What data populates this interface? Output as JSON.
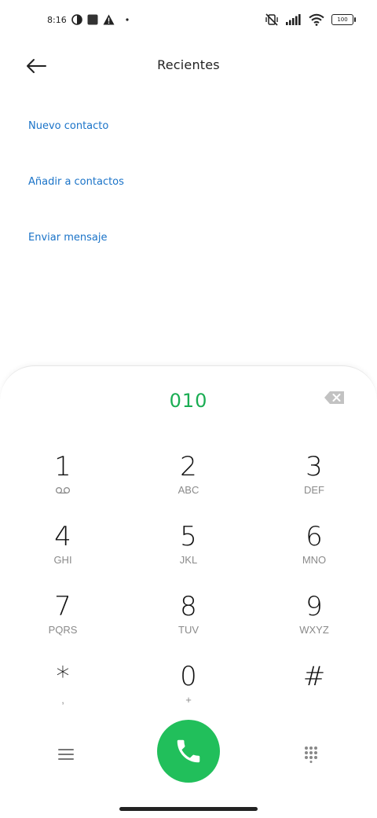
{
  "status_bar": {
    "time": "8:16",
    "battery_level": "100",
    "icons": [
      "data-saver-icon",
      "square-notification-icon",
      "warning-icon",
      "dot-icon",
      "vibrate-off-icon",
      "signal-icon",
      "wifi-icon",
      "battery-icon"
    ]
  },
  "header": {
    "title": "Recientes",
    "back_icon": "arrow-left-icon"
  },
  "actions": [
    {
      "label": "Nuevo contacto"
    },
    {
      "label": "Añadir a contactos"
    },
    {
      "label": "Enviar mensaje"
    }
  ],
  "dialer": {
    "number": "010",
    "keys": [
      {
        "digit": "1",
        "letters": "",
        "sub_icon": "voicemail-icon"
      },
      {
        "digit": "2",
        "letters": "ABC"
      },
      {
        "digit": "3",
        "letters": "DEF"
      },
      {
        "digit": "4",
        "letters": "GHI"
      },
      {
        "digit": "5",
        "letters": "JKL"
      },
      {
        "digit": "6",
        "letters": "MNO"
      },
      {
        "digit": "7",
        "letters": "PQRS"
      },
      {
        "digit": "8",
        "letters": "TUV"
      },
      {
        "digit": "9",
        "letters": "WXYZ"
      },
      {
        "digit": "*",
        "letters": ","
      },
      {
        "digit": "0",
        "letters": "+"
      },
      {
        "digit": "#",
        "letters": ""
      }
    ]
  },
  "colors": {
    "accent_link": "#1a73c8",
    "number_green": "#1aad53",
    "call_button": "#21bf5b"
  }
}
